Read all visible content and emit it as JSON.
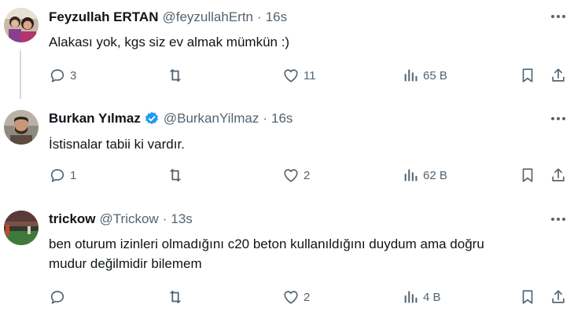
{
  "tweets": [
    {
      "name": "Feyzullah ERTAN",
      "handle": "@feyzullahErtn",
      "time": "16s",
      "text_lines": [
        "Alakası yok, kgs siz ev almak mümkün :)"
      ],
      "replies": "3",
      "retweets": "",
      "likes": "11",
      "views": "65 B",
      "verified": false,
      "avatar_icon": "two-women-avatar"
    },
    {
      "name": "Burkan Yılmaz",
      "handle": "@BurkanYilmaz",
      "time": "16s",
      "text_lines": [
        "İstisnalar tabii ki vardır."
      ],
      "replies": "1",
      "retweets": "",
      "likes": "2",
      "views": "62 B",
      "verified": true,
      "avatar_icon": "bearded-man-avatar"
    },
    {
      "name": "trickow",
      "handle": "@Trickow",
      "time": "13s",
      "text_lines": [
        "ben oturum izinleri olmadığını c20 beton kullanıldığını duydum ama doğru",
        "mudur değilmidir bilemem"
      ],
      "replies": "",
      "retweets": "",
      "likes": "2",
      "views": "4 B",
      "verified": false,
      "avatar_icon": "stadium-avatar"
    }
  ],
  "separator": "·",
  "colors": {
    "text": "#0f1419",
    "muted": "#536471",
    "verified": "#1d9bf0",
    "thread_line": "#cfd9de"
  }
}
